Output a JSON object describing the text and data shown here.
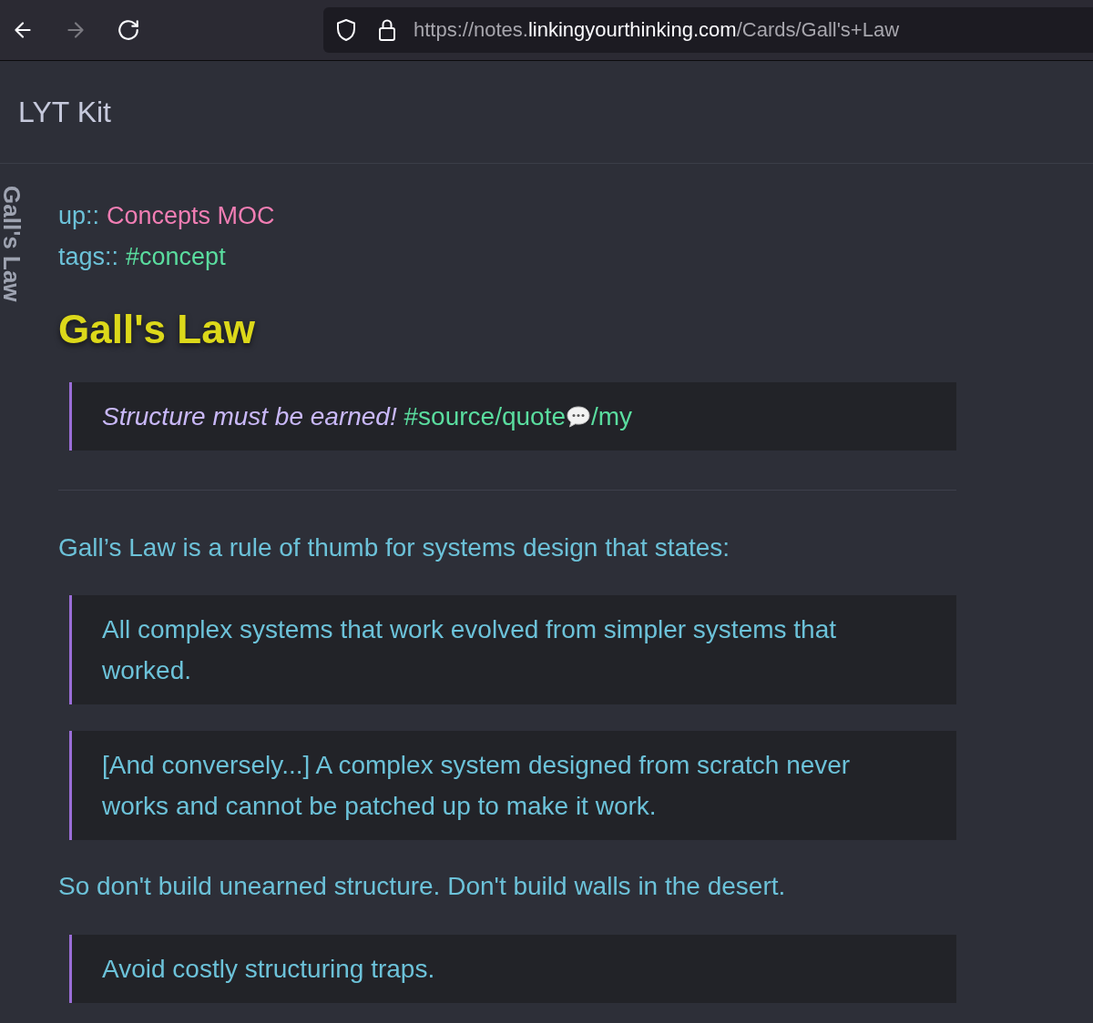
{
  "browser": {
    "nav": [
      {
        "kind": "back",
        "disabled": false
      },
      {
        "kind": "forward",
        "disabled": true
      },
      {
        "kind": "reload",
        "disabled": false
      }
    ],
    "url": {
      "prefix": "https://notes.",
      "domain": "linkingyourthinking.com",
      "path": "/Cards/Gall's+Law"
    }
  },
  "site": {
    "title": "LYT Kit"
  },
  "pane": {
    "vertical_title": "Gall's Law"
  },
  "note": {
    "properties": [
      {
        "key": "up::",
        "value": "Concepts MOC",
        "kind": "link"
      },
      {
        "key": "tags::",
        "value": "#concept",
        "kind": "tag"
      }
    ],
    "title": "Gall's Law",
    "blocks": [
      {
        "kind": "tagged_quote",
        "text": "Structure must be earned!",
        "tag": {
          "before_icon": "#source/quote",
          "after_icon": "/my"
        }
      },
      {
        "kind": "divider"
      },
      {
        "kind": "paragraph",
        "text": "Gall’s Law is a rule of thumb for systems design that states:"
      },
      {
        "kind": "quote",
        "text": "All complex systems that work evolved from simpler systems that worked."
      },
      {
        "kind": "quote",
        "text": "[And conversely...] A complex system designed from scratch never works and cannot be patched up to make it work."
      },
      {
        "kind": "paragraph",
        "text": "So don't build unearned structure. Don't build walls in the desert."
      },
      {
        "kind": "quote",
        "text": "Avoid costly structuring traps."
      }
    ]
  }
}
